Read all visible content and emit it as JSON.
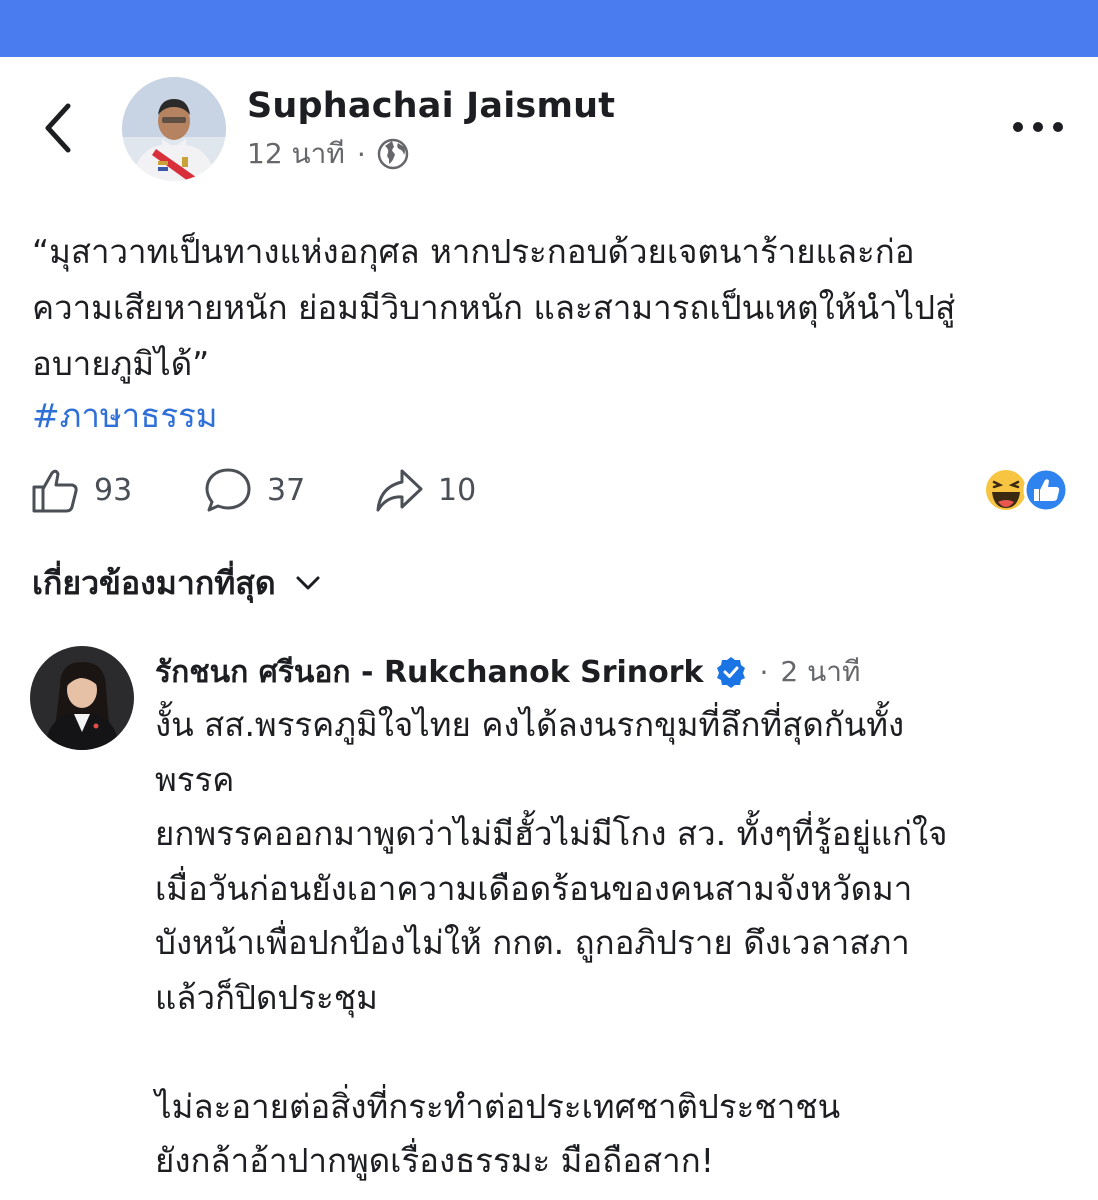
{
  "post": {
    "author": "Suphachai Jaismut",
    "time": "12 นาที",
    "separator": "·",
    "text_lines": [
      "“มุสาวาทเป็นทางแห่งอกุศล หากประกอบด้วยเจตนาร้ายและก่อ",
      "ความเสียหายหนัก ย่อมมีวิบากหนัก และสามารถเป็นเหตุให้นำไปสู่",
      "อบายภูมิได้”"
    ],
    "hashtag": "#ภาษาธรรม",
    "likes": "93",
    "comments": "37",
    "shares": "10"
  },
  "sort": {
    "label": "เกี่ยวข้องมากที่สุด"
  },
  "comment": {
    "author": "รักชนก ศรีนอก - Rukchanok Srinork",
    "separator": "·",
    "time": "2 นาที",
    "lines": [
      "งั้น สส.พรรคภูมิใจไทย คงได้ลงนรกขุมที่ลึกที่สุดกันทั้ง",
      "พรรค",
      "ยกพรรคออกมาพูดว่าไม่มีฮั้วไม่มีโกง สว. ทั้งๆที่รู้อยู่แก่ใจ",
      "เมื่อวันก่อนยังเอาความเดือดร้อนของคนสามจังหวัดมา",
      "บังหน้าเพื่อปกป้องไม่ให้ กกต. ถูกอภิปราย ดึงเวลาสภา",
      "แล้วก็ปิดประชุม",
      "",
      "ไม่ละอายต่อสิ่งที่กระทำต่อประเทศชาติประชาชน",
      "ยังกล้าอ้าปากพูดเรื่องธรรมะ มือถือสาก!"
    ]
  },
  "colors": {
    "topbar": "#4a7cf0",
    "link": "#2e6fd8",
    "verified": "#1b74e4",
    "secondary_text": "#65676b"
  },
  "icons": {
    "back": "back-arrow-icon",
    "globe": "globe-icon",
    "more": "more-dots-icon",
    "like": "thumbs-up-icon",
    "comment": "speech-bubble-icon",
    "share": "share-arrow-icon",
    "sort": "chevron-down-icon",
    "verified": "verified-badge-icon"
  }
}
